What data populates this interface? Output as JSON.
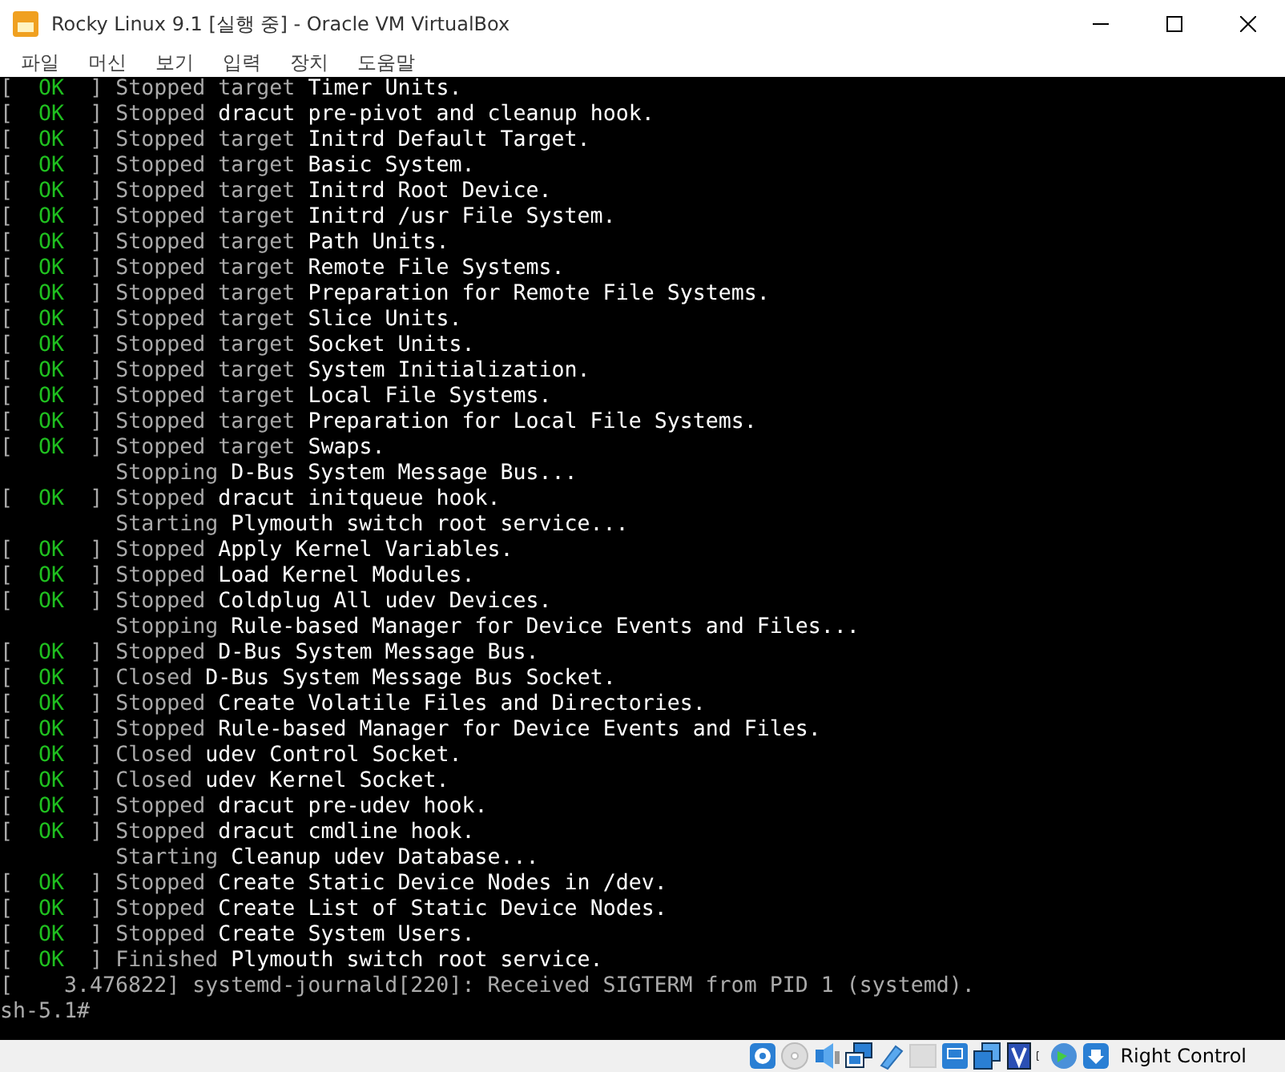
{
  "window": {
    "title": "Rocky Linux 9.1 [실행 중] - Oracle VM VirtualBox"
  },
  "menu": [
    "파일",
    "머신",
    "보기",
    "입력",
    "장치",
    "도움말"
  ],
  "console": [
    {
      "kind": "ok",
      "mark": [
        "[",
        "OK",
        "]"
      ],
      "verb": "Stopped target",
      "rest": "Timer Units."
    },
    {
      "kind": "ok",
      "mark": [
        "[",
        "OK",
        "]"
      ],
      "verb": "Stopped",
      "rest": "dracut pre-pivot and cleanup hook."
    },
    {
      "kind": "ok",
      "mark": [
        "[",
        "OK",
        "]"
      ],
      "verb": "Stopped target",
      "rest": "Initrd Default Target."
    },
    {
      "kind": "ok",
      "mark": [
        "[",
        "OK",
        "]"
      ],
      "verb": "Stopped target",
      "rest": "Basic System."
    },
    {
      "kind": "ok",
      "mark": [
        "[",
        "OK",
        "]"
      ],
      "verb": "Stopped target",
      "rest": "Initrd Root Device."
    },
    {
      "kind": "ok",
      "mark": [
        "[",
        "OK",
        "]"
      ],
      "verb": "Stopped target",
      "rest": "Initrd /usr File System."
    },
    {
      "kind": "ok",
      "mark": [
        "[",
        "OK",
        "]"
      ],
      "verb": "Stopped target",
      "rest": "Path Units."
    },
    {
      "kind": "ok",
      "mark": [
        "[",
        "OK",
        "]"
      ],
      "verb": "Stopped target",
      "rest": "Remote File Systems."
    },
    {
      "kind": "ok",
      "mark": [
        "[",
        "OK",
        "]"
      ],
      "verb": "Stopped target",
      "rest": "Preparation for Remote File Systems."
    },
    {
      "kind": "ok",
      "mark": [
        "[",
        "OK",
        "]"
      ],
      "verb": "Stopped target",
      "rest": "Slice Units."
    },
    {
      "kind": "ok",
      "mark": [
        "[",
        "OK",
        "]"
      ],
      "verb": "Stopped target",
      "rest": "Socket Units."
    },
    {
      "kind": "ok",
      "mark": [
        "[",
        "OK",
        "]"
      ],
      "verb": "Stopped target",
      "rest": "System Initialization."
    },
    {
      "kind": "ok",
      "mark": [
        "[",
        "OK",
        "]"
      ],
      "verb": "Stopped target",
      "rest": "Local File Systems."
    },
    {
      "kind": "ok",
      "mark": [
        "[",
        "OK",
        "]"
      ],
      "verb": "Stopped target",
      "rest": "Preparation for Local File Systems."
    },
    {
      "kind": "ok",
      "mark": [
        "[",
        "OK",
        "]"
      ],
      "verb": "Stopped target",
      "rest": "Swaps."
    },
    {
      "kind": "job",
      "verb": "Stopping",
      "rest": "D-Bus System Message Bus..."
    },
    {
      "kind": "ok",
      "mark": [
        "[",
        "OK",
        "]"
      ],
      "verb": "Stopped",
      "rest": "dracut initqueue hook."
    },
    {
      "kind": "job",
      "verb": "Starting",
      "rest": "Plymouth switch root service..."
    },
    {
      "kind": "ok",
      "mark": [
        "[",
        "OK",
        "]"
      ],
      "verb": "Stopped",
      "rest": "Apply Kernel Variables."
    },
    {
      "kind": "ok",
      "mark": [
        "[",
        "OK",
        "]"
      ],
      "verb": "Stopped",
      "rest": "Load Kernel Modules."
    },
    {
      "kind": "ok",
      "mark": [
        "[",
        "OK",
        "]"
      ],
      "verb": "Stopped",
      "rest": "Coldplug All udev Devices."
    },
    {
      "kind": "job",
      "verb": "Stopping",
      "rest": "Rule-based Manager for Device Events and Files..."
    },
    {
      "kind": "ok",
      "mark": [
        "[",
        "OK",
        "]"
      ],
      "verb": "Stopped",
      "rest": "D-Bus System Message Bus."
    },
    {
      "kind": "ok",
      "mark": [
        "[",
        "OK",
        "]"
      ],
      "verb": "Closed",
      "rest": "D-Bus System Message Bus Socket."
    },
    {
      "kind": "ok",
      "mark": [
        "[",
        "OK",
        "]"
      ],
      "verb": "Stopped",
      "rest": "Create Volatile Files and Directories."
    },
    {
      "kind": "ok",
      "mark": [
        "[",
        "OK",
        "]"
      ],
      "verb": "Stopped",
      "rest": "Rule-based Manager for Device Events and Files."
    },
    {
      "kind": "ok",
      "mark": [
        "[",
        "OK",
        "]"
      ],
      "verb": "Closed",
      "rest": "udev Control Socket."
    },
    {
      "kind": "ok",
      "mark": [
        "[",
        "OK",
        "]"
      ],
      "verb": "Closed",
      "rest": "udev Kernel Socket."
    },
    {
      "kind": "ok",
      "mark": [
        "[",
        "OK",
        "]"
      ],
      "verb": "Stopped",
      "rest": "dracut pre-udev hook."
    },
    {
      "kind": "ok",
      "mark": [
        "[",
        "OK",
        "]"
      ],
      "verb": "Stopped",
      "rest": "dracut cmdline hook."
    },
    {
      "kind": "job",
      "verb": "Starting",
      "rest": "Cleanup udev Database..."
    },
    {
      "kind": "ok",
      "mark": [
        "[",
        "OK",
        "]"
      ],
      "verb": "Stopped",
      "rest": "Create Static Device Nodes in /dev."
    },
    {
      "kind": "ok",
      "mark": [
        "[",
        "OK",
        "]"
      ],
      "verb": "Stopped",
      "rest": "Create List of Static Device Nodes."
    },
    {
      "kind": "ok",
      "mark": [
        "[",
        "OK",
        "]"
      ],
      "verb": "Stopped",
      "rest": "Create System Users."
    },
    {
      "kind": "ok",
      "mark": [
        "[",
        "OK",
        "]"
      ],
      "verb": "Finished",
      "rest": "Plymouth switch root service."
    },
    {
      "kind": "kernel",
      "text": "[    3.476822] systemd-journald[220]: Received SIGTERM from PID 1 (systemd)."
    },
    {
      "kind": "prompt",
      "text": "sh-5.1#"
    }
  ],
  "status_bar": {
    "host_key": "Right Control"
  }
}
